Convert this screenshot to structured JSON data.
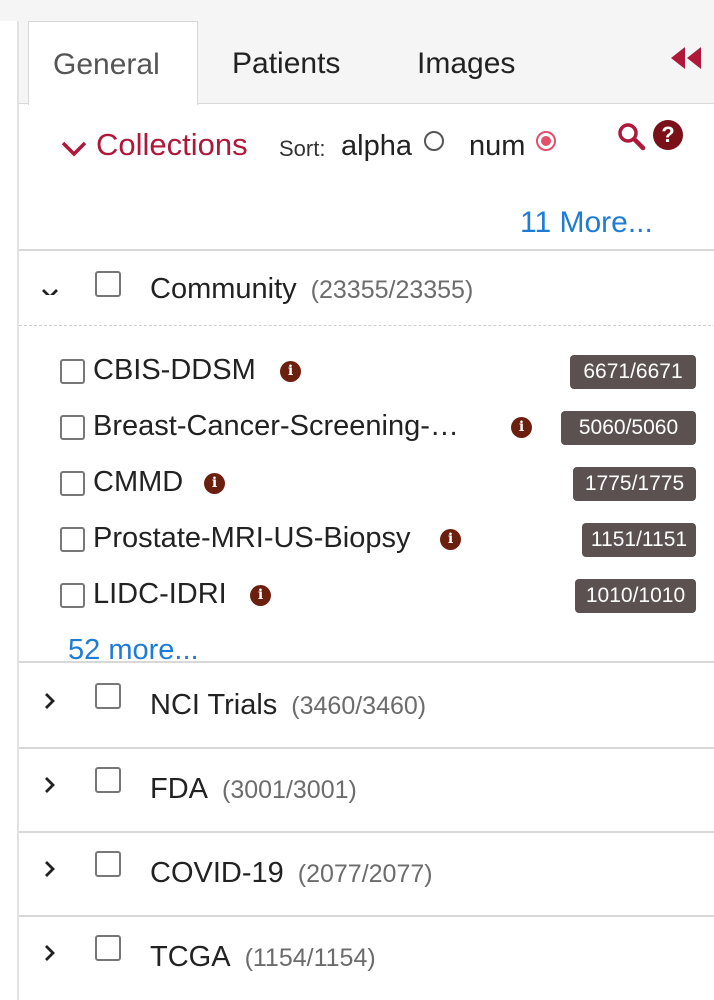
{
  "tabs": [
    {
      "label": "General",
      "active": true
    },
    {
      "label": "Patients",
      "active": false
    },
    {
      "label": "Images",
      "active": false
    }
  ],
  "collapse_icon": "double-chevron-left-icon",
  "collections": {
    "title": "Collections",
    "sort_label": "Sort:",
    "sort_options": [
      {
        "label": "alpha",
        "selected": false
      },
      {
        "label": "num",
        "selected": true
      }
    ],
    "more_link": "11 More...",
    "search_icon": "search-icon",
    "help_icon": "question-circle-icon",
    "help_glyph": "?"
  },
  "colors": {
    "accent": "#b0183a",
    "link": "#1e7bd6",
    "badge": "#5b5150",
    "info": "#6b1f0f"
  },
  "groups": [
    {
      "name": "Community",
      "count": "(23355/23355)",
      "expanded": true,
      "items": [
        {
          "label": "CBIS-DDSM",
          "count": "6671/6671"
        },
        {
          "label": "Breast-Cancer-Screening-…",
          "count": "5060/5060"
        },
        {
          "label": "CMMD",
          "count": "1775/1775"
        },
        {
          "label": "Prostate-MRI-US-Biopsy",
          "count": "1151/1151"
        },
        {
          "label": "LIDC-IDRI",
          "count": "1010/1010"
        }
      ],
      "more_link": "52 more..."
    },
    {
      "name": "NCI Trials",
      "count": "(3460/3460)",
      "expanded": false
    },
    {
      "name": "FDA",
      "count": "(3001/3001)",
      "expanded": false
    },
    {
      "name": "COVID-19",
      "count": "(2077/2077)",
      "expanded": false
    },
    {
      "name": "TCGA",
      "count": "(1154/1154)",
      "expanded": false
    }
  ],
  "info_glyph": "i"
}
